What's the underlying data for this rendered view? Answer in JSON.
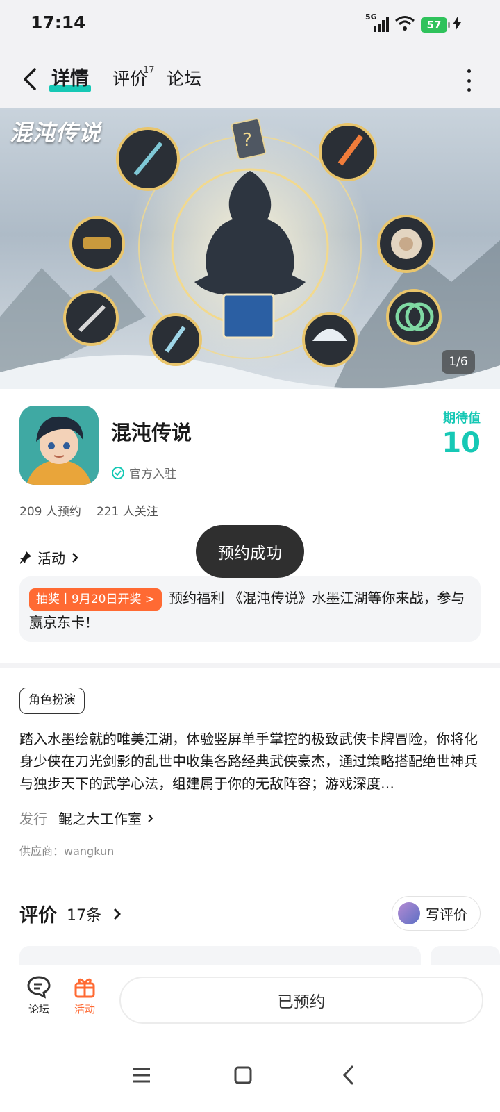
{
  "status_bar": {
    "time": "17:14",
    "network": "5G",
    "battery": "57"
  },
  "nav": {
    "tabs": [
      {
        "label": "详情"
      },
      {
        "label": "评价",
        "badge": "17"
      },
      {
        "label": "论坛"
      }
    ]
  },
  "banner": {
    "title": "混沌传说",
    "page_indicator": "1/6"
  },
  "app": {
    "name": "混沌传说",
    "official_label": "官方入驻",
    "expect_label": "期待值",
    "expect_value": "10",
    "reservations": "209 人预约",
    "followers": "221 人关注"
  },
  "activity": {
    "header": "活动",
    "badge": "抽奖丨9月20日开奖 >",
    "text": "预约福利 《混沌传说》水墨江湖等你来战，参与赢京东卡！"
  },
  "toast": "预约成功",
  "detail": {
    "tag": "角色扮演",
    "description": "踏入水墨绘就的唯美江湖，体验竖屏单手掌控的极致武侠卡牌冒险，你将化身少侠在刀光剑影的乱世中收集各路经典武侠豪杰，通过策略搭配绝世神兵与独步天下的武学心法，组建属于你的无敌阵容；游戏深度…",
    "publisher_label": "发行",
    "publisher_name": "鲲之大工作室",
    "supplier": "供应商：wangkun"
  },
  "reviews": {
    "title": "评价",
    "count": "17条",
    "write_label": "写评价"
  },
  "bottom_bar": {
    "forum_label": "论坛",
    "activity_label": "活动",
    "reserved_label": "已预约"
  },
  "colors": {
    "accent": "#16c8b5",
    "orange": "#ff6a33",
    "toast_bg": "#2f2f2f"
  }
}
